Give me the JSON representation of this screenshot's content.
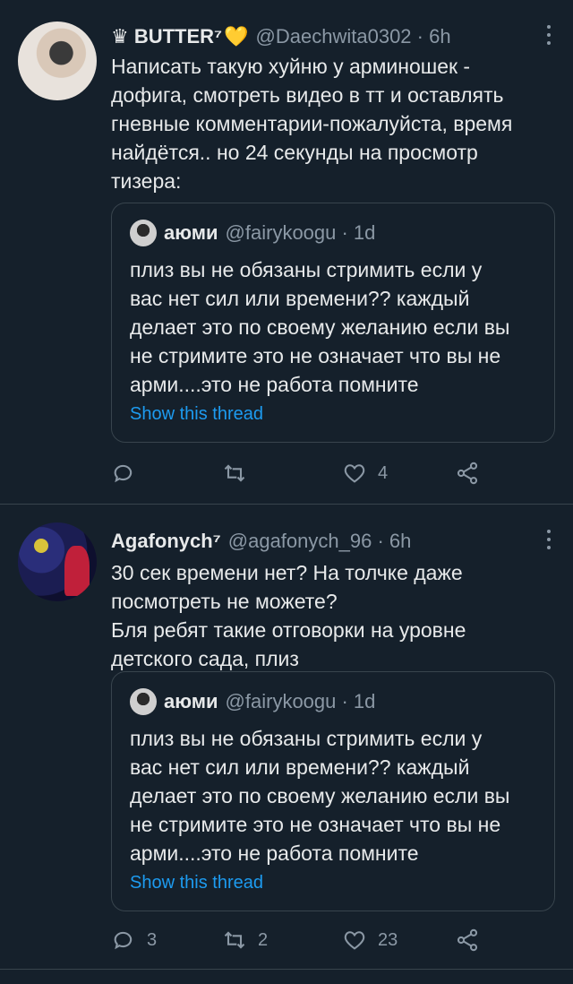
{
  "tweets": [
    {
      "name": "♛ BUTTER⁷",
      "name_emoji": "💛",
      "handle": "@Daechwita0302 · 6h",
      "text": "Написать такую хуйню у арминошек -\nдофига, смотреть видео в тт и оставлять\nгневные комментарии-пожалуйста, время\nнайдётся.. но 24 секунды на просмотр\nтизера:",
      "quote": {
        "name": "аюми",
        "handle": "@fairykoogu · 1d",
        "text": "плиз вы не обязаны стримить если у\nвас нет сил или времени?? каждый\nделает это по своему желанию если вы\nне стримите это не означает что вы не\nарми....это не работа помните",
        "thread_link": "Show this thread"
      },
      "counts": {
        "reply": "",
        "retweet": "",
        "like": "4"
      }
    },
    {
      "name": "Agafonych⁷",
      "name_emoji": "",
      "handle": "@agafonych_96 · 6h",
      "text": "30 сек времени нет? На толчке даже\nпосмотреть не можете?\nБля ребят такие отговорки на уровне\nдетского сада, плиз",
      "quote": {
        "name": "аюми",
        "handle": "@fairykoogu · 1d",
        "text": "плиз вы не обязаны стримить если у\nвас нет сил или времени?? каждый\nделает это по своему желанию если вы\nне стримите это не означает что вы не\nарми....это не работа помните",
        "thread_link": "Show this thread"
      },
      "counts": {
        "reply": "3",
        "retweet": "2",
        "like": "23"
      }
    }
  ],
  "icons": {
    "reply": "reply-icon",
    "retweet": "retweet-icon",
    "like": "heart-icon",
    "share": "share-icon",
    "more": "more-options-icon"
  },
  "colors": {
    "background": "#15202b",
    "text": "#e7e9ea",
    "secondary": "#8b98a5",
    "link": "#1d9bf0",
    "border": "#38444d"
  }
}
